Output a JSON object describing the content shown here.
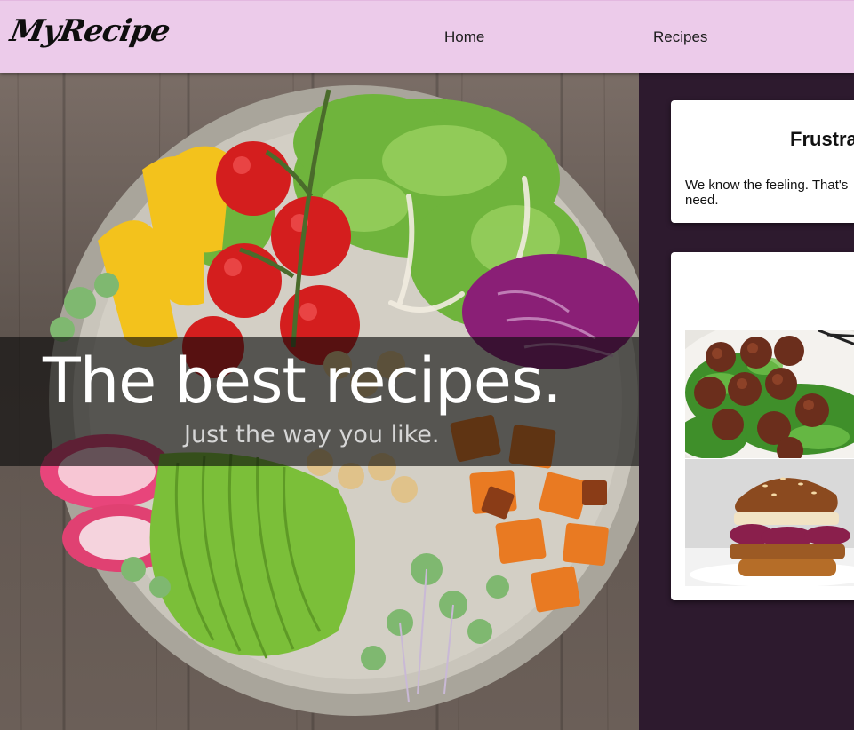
{
  "navbar": {
    "logo": "MyRecipe",
    "links": [
      {
        "label": "Home"
      },
      {
        "label": "Recipes"
      }
    ],
    "background": "#eccbea"
  },
  "hero": {
    "title": "The best recipes.",
    "subtitle": "Just the way you like.",
    "image": "salad-bowl"
  },
  "side": {
    "background": "#2d1a2e",
    "intro_card": {
      "heading": "Frustra",
      "text": "We know the feeling. That's\nneed."
    },
    "gallery": {
      "images": [
        "meatballs-on-greens",
        "pulled-burger"
      ]
    }
  }
}
